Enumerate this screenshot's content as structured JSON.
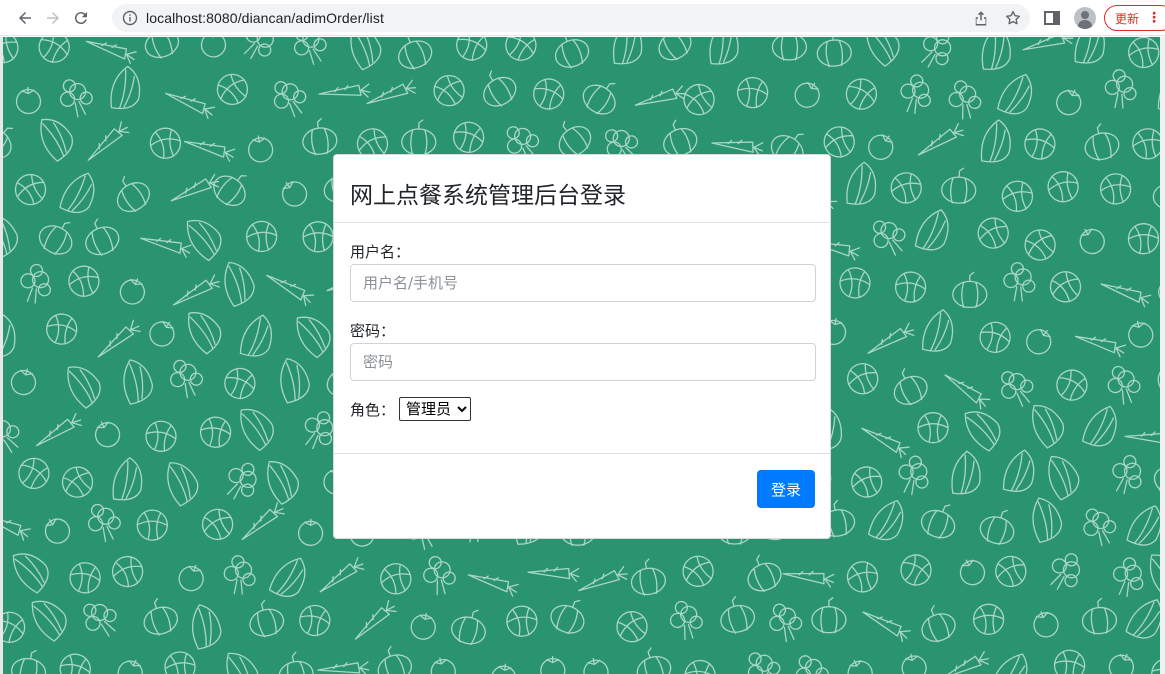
{
  "browser": {
    "url": "localhost:8080/diancan/adimOrder/list",
    "update_label": "更新",
    "icons": [
      "back-icon",
      "forward-icon",
      "reload-icon",
      "info-icon",
      "share-icon",
      "star-icon",
      "sidepanel-icon",
      "profile-icon",
      "menu-icon"
    ]
  },
  "page": {
    "background_color": "#2a9370",
    "pattern_color": "#bfe3d4"
  },
  "login": {
    "title": "网上点餐系统管理后台登录",
    "username_label": "用户名：",
    "username_placeholder": "用户名/手机号",
    "password_label": "密码：",
    "password_placeholder": "密码",
    "role_label": "角色：",
    "role_selected": "管理员",
    "submit_label": "登录",
    "accent_color": "#007bff"
  }
}
